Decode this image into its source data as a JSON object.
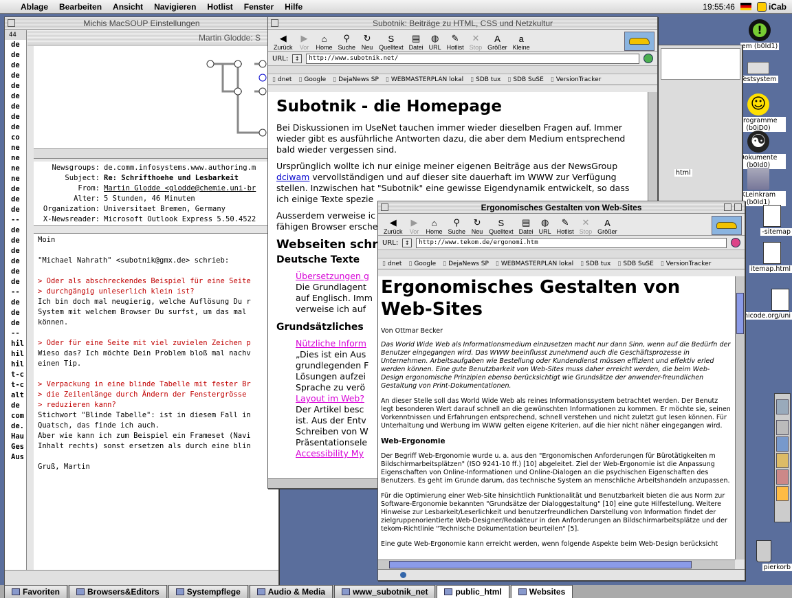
{
  "menubar": {
    "apple": "",
    "items": [
      "Ablage",
      "Bearbeiten",
      "Ansicht",
      "Navigieren",
      "Hotlist",
      "Fenster",
      "Hilfe"
    ],
    "clock": "19:55:46",
    "app": "iCab"
  },
  "desktop": {
    "icons": [
      {
        "label": "em (b0Id1)",
        "name": "alert-drive-icon"
      },
      {
        "label": "Testsystem",
        "name": "drive-icon"
      },
      {
        "label": "Programme (b0iD0)",
        "name": "smiley-drive-icon"
      },
      {
        "label": "Dokumente (b0Id0)",
        "name": "yinyang-drive-icon"
      },
      {
        "label": "KLeinkram (b0Id1)",
        "name": "kleinkram-drive-icon"
      },
      {
        "label": "-sitemap",
        "name": "text-file-icon"
      },
      {
        "label": "itemap.html",
        "name": "html-file-icon"
      },
      {
        "label": "unicode.org/uni",
        "name": "url-file-icon"
      },
      {
        "label": "pierkorb",
        "name": "trash-icon"
      }
    ]
  },
  "soup": {
    "title": "Michis MacSOUP Einstellungen",
    "subtitle": "Martin Glodde: S",
    "counter": "44",
    "left_col": [
      "de",
      "de",
      "de",
      "de",
      "de",
      "de",
      "de",
      "de",
      "de",
      "co",
      "ne",
      "ne",
      "ne",
      "ne",
      "de",
      "de",
      "de",
      "--",
      "de",
      "de",
      "de",
      "de",
      "de",
      "de",
      "--",
      "de",
      "de",
      "de",
      "--",
      "hil",
      "hil",
      "hil",
      "t-c",
      "t-c",
      "alt",
      "de",
      "com",
      "de.",
      "Hau",
      "Ges",
      "Aus"
    ],
    "headers": [
      {
        "k": "Newsgroups:",
        "v": "de.comm.infosystems.www.authoring.m"
      },
      {
        "k": "Subject:",
        "v": "Re: Schrifthoehe und Lesbarkeit"
      },
      {
        "k": "From:",
        "v": "Martin Glodde <glodde@chemie.uni-br"
      },
      {
        "k": "Alter:",
        "v": "5 Stunden, 46 Minuten"
      },
      {
        "k": "Organization:",
        "v": "Universitaet Bremen, Germany"
      },
      {
        "k": "X-Newsreader:",
        "v": "Microsoft Outlook Express 5.50.4522"
      }
    ],
    "body": [
      {
        "t": "Moin",
        "q": false
      },
      {
        "t": "",
        "q": false
      },
      {
        "t": "\"Michael Nahrath\" <subotnik@gmx.de> schrieb:",
        "q": false
      },
      {
        "t": "",
        "q": false
      },
      {
        "t": "> Oder als abschreckendes Beispiel für eine Seite",
        "q": true
      },
      {
        "t": "> durchgängig unleserlich klein ist?",
        "q": true
      },
      {
        "t": "Ich bin doch mal neugierig, welche Auflösung Du r",
        "q": false
      },
      {
        "t": "System mit welchem Browser Du surfst, um das mal",
        "q": false
      },
      {
        "t": "können.",
        "q": false
      },
      {
        "t": "",
        "q": false
      },
      {
        "t": "> Oder für eine Seite mit viel zuvielen Zeichen p",
        "q": true
      },
      {
        "t": "Wieso das? Ich möchte Dein Problem bloß mal nachv",
        "q": false
      },
      {
        "t": "einen Tip.",
        "q": false
      },
      {
        "t": "",
        "q": false
      },
      {
        "t": "> Verpackung in eine blinde Tabelle mit fester Br",
        "q": true
      },
      {
        "t": "> die Zeilenlänge durch Ändern der Fenstergrösse",
        "q": true
      },
      {
        "t": "> reduzieren kann?",
        "q": true
      },
      {
        "t": "Stichwort \"Blinde Tabelle\": ist in diesem Fall in",
        "q": false
      },
      {
        "t": "Quatsch, das finde ich auch.",
        "q": false
      },
      {
        "t": "Aber wie kann ich zum Beispiel ein Frameset (Navi",
        "q": false
      },
      {
        "t": "Inhalt rechts) sonst ersetzen als durch eine blin",
        "q": false
      },
      {
        "t": "",
        "q": false
      },
      {
        "t": "Gruß, Martin",
        "q": false
      }
    ]
  },
  "toolbar": {
    "buttons": [
      {
        "label": "Zurück",
        "icon": "back-arrow-icon",
        "glyph": "◀",
        "enabled": true
      },
      {
        "label": "Vor",
        "icon": "forward-arrow-icon",
        "glyph": "▶",
        "enabled": false
      },
      {
        "label": "Home",
        "icon": "home-icon",
        "glyph": "⌂",
        "enabled": true
      },
      {
        "label": "Suche",
        "icon": "search-icon",
        "glyph": "⚲",
        "enabled": true
      },
      {
        "label": "Neu",
        "icon": "reload-icon",
        "glyph": "↻",
        "enabled": true
      },
      {
        "label": "Quelltext",
        "icon": "source-icon",
        "glyph": "S",
        "enabled": true
      },
      {
        "label": "Datei",
        "icon": "file-icon",
        "glyph": "▤",
        "enabled": true
      },
      {
        "label": "URL",
        "icon": "globe-icon",
        "glyph": "◍",
        "enabled": true
      },
      {
        "label": "Hotlist",
        "icon": "hotlist-icon",
        "glyph": "✎",
        "enabled": true
      },
      {
        "label": "Stop",
        "icon": "stop-icon",
        "glyph": "✕",
        "enabled": false
      },
      {
        "label": "Größer",
        "icon": "font-bigger-icon",
        "glyph": "A",
        "enabled": true
      },
      {
        "label": "Kleine",
        "icon": "font-smaller-icon",
        "glyph": "a",
        "enabled": true
      }
    ],
    "bookmarks": [
      "dnet",
      "Google",
      "DejaNews SP",
      "WEBMASTERPLAN lokal",
      "SDB tux",
      "SDB SuSE",
      "VersionTracker"
    ]
  },
  "subotnik": {
    "title": "Subotnik: Beiträge zu HTML, CSS und Netzkultur",
    "url_label": "URL:",
    "url": "http://www.subotnik.net/",
    "h1": "Subotnik - die Homepage",
    "p1": "Bei Diskussionen im UseNet tauchen immer wieder dieselben Fragen auf. Immer wieder gibt es ausführliche Antworten dazu, die aber dem Medium entsprechend bald wieder vergessen sind.",
    "p2a": "Ursprünglich wollte ich nur einige meiner eigenen Beiträge aus der NewsGroup",
    "p2link": "dciwam",
    "p2b": " vervollständigen und auf dieser site dauerhaft im WWW zur Verfügung stellen. Inzwischen hat \"Subotnik\" eine gewisse Eigendynamik entwickelt, so dass ich einige Texte spezie",
    "p3": "Ausserdem verweise ic fähigen Browser ersche",
    "h2": "Webseiten schr",
    "h3a": "Deutsche Texte",
    "li1": "Übersetzungen g",
    "li1txt": "Die Grundlagent auf Englisch. Imm verweise ich auf",
    "h3b": "Grundsätzliches",
    "li2": "Nützliche Inform",
    "li2txt": "„Dies ist ein Aus grundlegenden F Lösungen aufzei Sprache zu verö",
    "li3": "Layout im Web?",
    "li3txt": "Der Artikel besc ist. Aus der Entv Schreiben von W Präsentationsele",
    "li4": "Accessibility My"
  },
  "ergo": {
    "title": "Ergonomisches Gestalten von Web-Sites",
    "url_label": "URL:",
    "url": "http://www.tekom.de/ergonomi.htm",
    "h1": "Ergonomisches Gestalten von Web-Sites",
    "author": "Von Ottmar Becker",
    "intro": "Das World Wide Web als Informationsmedium einzusetzen macht nur dann Sinn, wenn auf die Bedürfn der Benutzer eingegangen wird. Das WWW beeinflusst zunehmend auch die Geschäftsprozesse in Unternehmen. Arbeitsaufgaben wie Bestellung oder Kundendienst müssen effizient und effektiv erled werden können. Eine gute Benutzbarkeit von Web-Sites muss daher erreicht werden, die beim Web-Design ergonomische Prinzipien ebenso berücksichtigt wie Grundsätze der anwender-freundlichen Gestaltung von Print-Dokumentationen.",
    "p1": "An dieser Stelle soll das World Wide Web als reines Informationssystem betrachtet werden. Der Benutz legt besonderen Wert darauf schnell an die gewünschten Informationen zu kommen. Er möchte sie, seinen Vorkenntnissen und Erfahrungen entsprechend, schnell verstehen und nicht zuletzt gut lesen können. Für Unterhaltung und Werbung im WWW gelten eigene Kriterien, auf die hier nicht näher eingegangen wird.",
    "h2": "Web-Ergonomie",
    "p2": "Der Begriff Web-Ergonomie wurde u. a. aus den \"Ergonomischen Anforderungen für Bürotätigkeiten m Bildschirmarbeitsplätzen\" (ISO 9241-10 ff.) [10] abgeleitet. Ziel der Web-Ergonomie ist die Anpassung Eigenschaften von Online-Informationen und Online-Dialogen an die psychischen Eigenschaften des Benutzers. Es geht im Grunde darum, das technische System an menschliche Arbeitshandeln anzupassen.",
    "p3": "Für die Optimierung einer Web-Site hinsichtlich Funktionalität und Benutzbarkeit bieten die aus Norm zur Software-Ergonomie bekannten \"Grundsätze der Dialoggestaltung\" [10] eine gute Hilfestellung. Weitere Hinweise zur Lesbarkeit/Leserlichkeit und benutzerfreundlichen Darstellung von Information findet der zielgruppenorientierte Web-Designer/Redakteur in den Anforderungen an Bildschirmarbeitsplätze und der tekom-Richtlinie \"Technische Dokumentation beurteilen\" [5].",
    "p4": "Eine gute Web-Ergonomie kann erreicht werden, wenn folgende Aspekte beim Web-Design berücksicht"
  },
  "behind": {
    "left_text": "html"
  },
  "taskbar": {
    "tabs": [
      "Favoriten",
      "Browsers&Editors",
      "Systempflege",
      "Audio & Media",
      "www_subotnik_net",
      "public_html",
      "Websites"
    ]
  },
  "colors": {
    "quote": "#c00000",
    "link": "#0000cc",
    "visited": "#d600d6",
    "desktop": "#5a6e9c"
  }
}
